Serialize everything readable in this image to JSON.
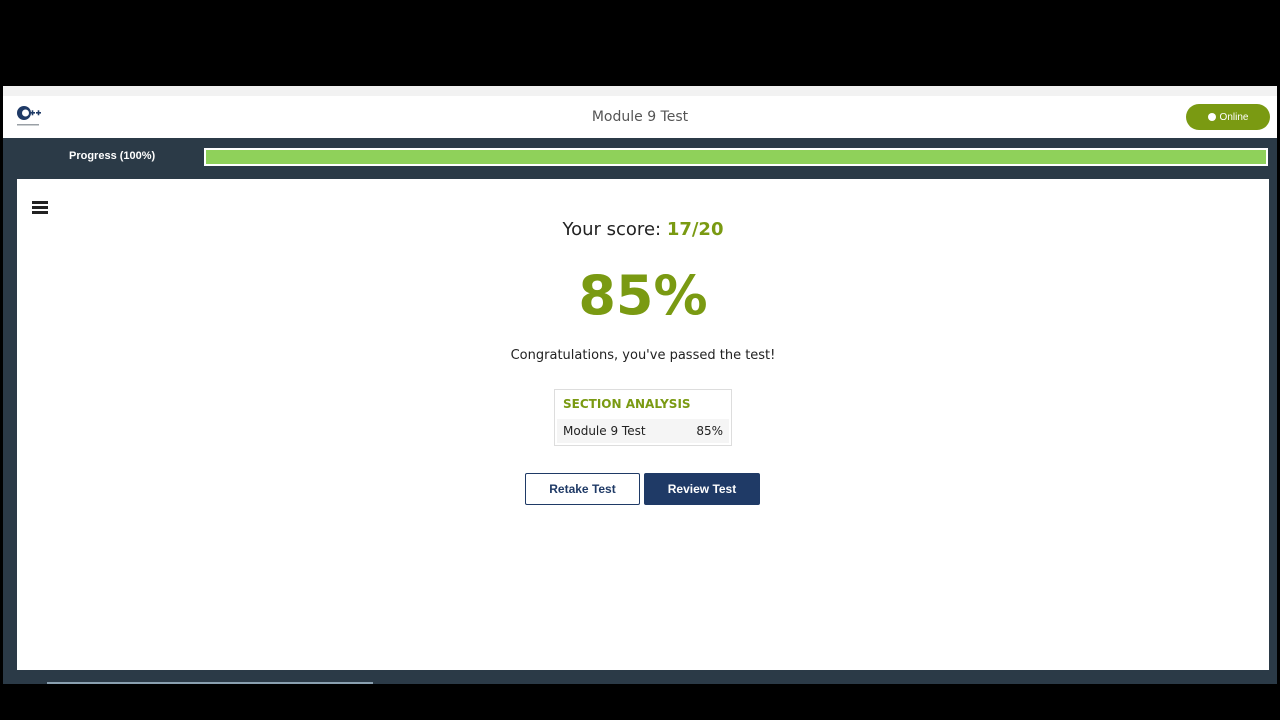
{
  "header": {
    "title": "Module 9 Test",
    "status_label": "Online",
    "logo_icon": "cpp-institute-logo-icon"
  },
  "progress": {
    "label": "Progress (100%)",
    "fraction": 1.0,
    "fill_color": "#8fd15a"
  },
  "result": {
    "score_prefix": "Your score:",
    "score_value": "17/20",
    "percent": "85%",
    "message": "Congratulations, you've passed the test!"
  },
  "section_analysis": {
    "title": "SECTION ANALYSIS",
    "rows": [
      {
        "name": "Module 9 Test",
        "value": "85%"
      }
    ]
  },
  "actions": {
    "retake_label": "Retake Test",
    "review_label": "Review Test"
  },
  "colors": {
    "accent_green": "#7a9a12",
    "primary_blue": "#1f3a66",
    "frame": "#2b3a47"
  }
}
